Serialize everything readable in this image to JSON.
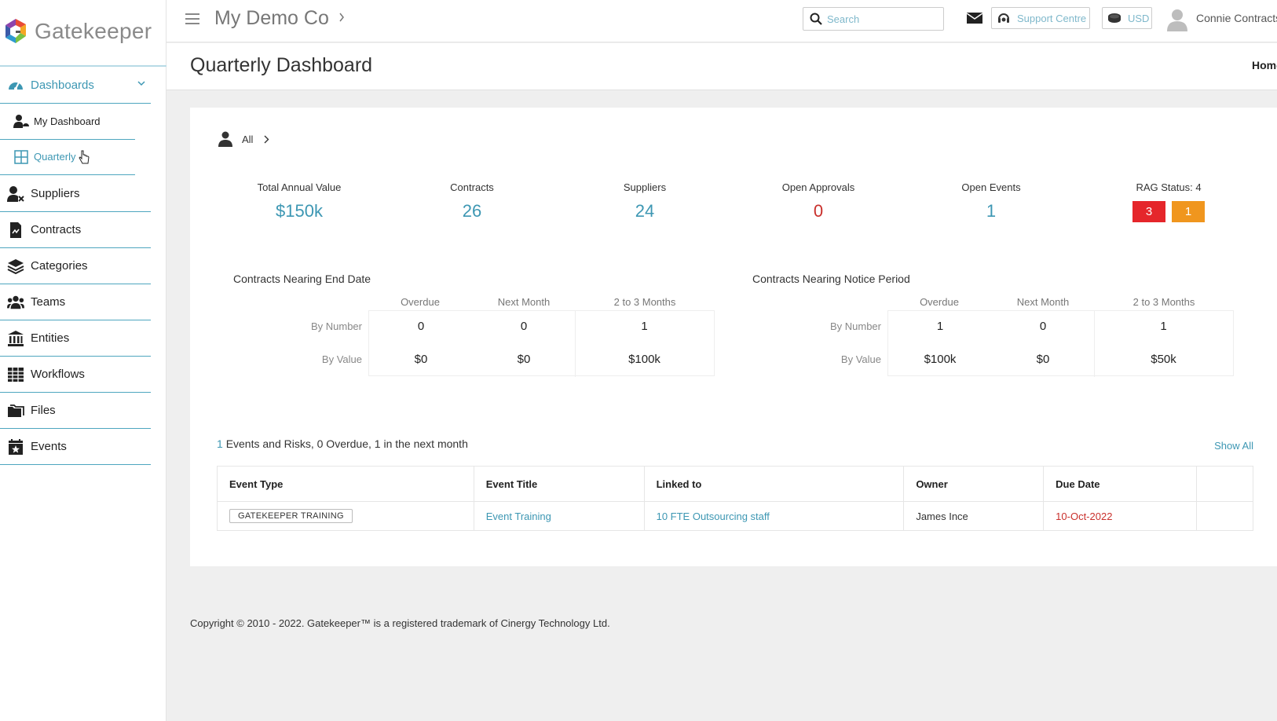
{
  "brand": {
    "name": "Gatekeeper"
  },
  "sidebar": {
    "items": [
      {
        "id": "dashboards",
        "label": "Dashboards",
        "icon": "speedometer-icon",
        "active": true
      },
      {
        "id": "suppliers",
        "label": "Suppliers",
        "icon": "user-tools-icon"
      },
      {
        "id": "contracts",
        "label": "Contracts",
        "icon": "document-icon"
      },
      {
        "id": "categories",
        "label": "Categories",
        "icon": "layers-icon"
      },
      {
        "id": "teams",
        "label": "Teams",
        "icon": "users-icon"
      },
      {
        "id": "entities",
        "label": "Entities",
        "icon": "bank-icon"
      },
      {
        "id": "workflows",
        "label": "Workflows",
        "icon": "table-icon"
      },
      {
        "id": "files",
        "label": "Files",
        "icon": "folder-icon"
      },
      {
        "id": "events",
        "label": "Events",
        "icon": "calendar-star-icon"
      }
    ],
    "subitems": [
      {
        "id": "my-dashboard",
        "label": "My Dashboard",
        "icon": "user-gauge-icon"
      },
      {
        "id": "quarterly",
        "label": "Quarterly",
        "icon": "grid-icon",
        "active": true
      }
    ]
  },
  "header": {
    "company": "My Demo Co",
    "search_placeholder": "Search",
    "support_label": "Support Centre",
    "currency": "USD",
    "user_name": "Connie Contracts"
  },
  "page": {
    "title": "Quarterly Dashboard",
    "breadcrumb_home": "Home"
  },
  "filter": {
    "label": "All"
  },
  "kpis": [
    {
      "label": "Total Annual Value",
      "value": "$150k"
    },
    {
      "label": "Contracts",
      "value": "26"
    },
    {
      "label": "Suppliers",
      "value": "24"
    },
    {
      "label": "Open Approvals",
      "value": "0",
      "color": "#c9302c"
    },
    {
      "label": "Open Events",
      "value": "1"
    },
    {
      "label": "RAG Status: 4",
      "rag": [
        {
          "value": "3",
          "color": "#e5262b"
        },
        {
          "value": "1",
          "color": "#f0961e"
        }
      ]
    }
  ],
  "end_date": {
    "title": "Contracts Nearing End Date",
    "columns": [
      "Overdue",
      "Next Month",
      "2 to 3 Months"
    ],
    "rows": [
      {
        "label": "By Number",
        "values": [
          "0",
          "0",
          "1"
        ]
      },
      {
        "label": "By Value",
        "values": [
          "$0",
          "$0",
          "$100k"
        ]
      }
    ]
  },
  "notice_period": {
    "title": "Contracts Nearing Notice Period",
    "columns": [
      "Overdue",
      "Next Month",
      "2 to 3 Months"
    ],
    "rows": [
      {
        "label": "By Number",
        "values": [
          "1",
          "0",
          "1"
        ]
      },
      {
        "label": "By Value",
        "values": [
          "$100k",
          "$0",
          "$50k"
        ]
      }
    ]
  },
  "events": {
    "summary_count": "1",
    "summary_text": "Events and Risks, 0 Overdue, 1 in the next month",
    "show_all": "Show All",
    "columns": [
      "Event Type",
      "Event Title",
      "Linked to",
      "Owner",
      "Due Date"
    ],
    "rows": [
      {
        "type": "GATEKEEPER TRAINING",
        "title": "Event Training",
        "linked": "10 FTE Outsourcing staff",
        "owner": "James Ince",
        "due": "10-Oct-2022"
      }
    ]
  },
  "footer": {
    "text": "Copyright © 2010 - 2022. Gatekeeper™ is a registered trademark of Cinergy Technology Ltd."
  },
  "colors": {
    "accent": "#3d97b3",
    "danger": "#c9302c",
    "sidebar_rule": "#4ea6bf"
  }
}
